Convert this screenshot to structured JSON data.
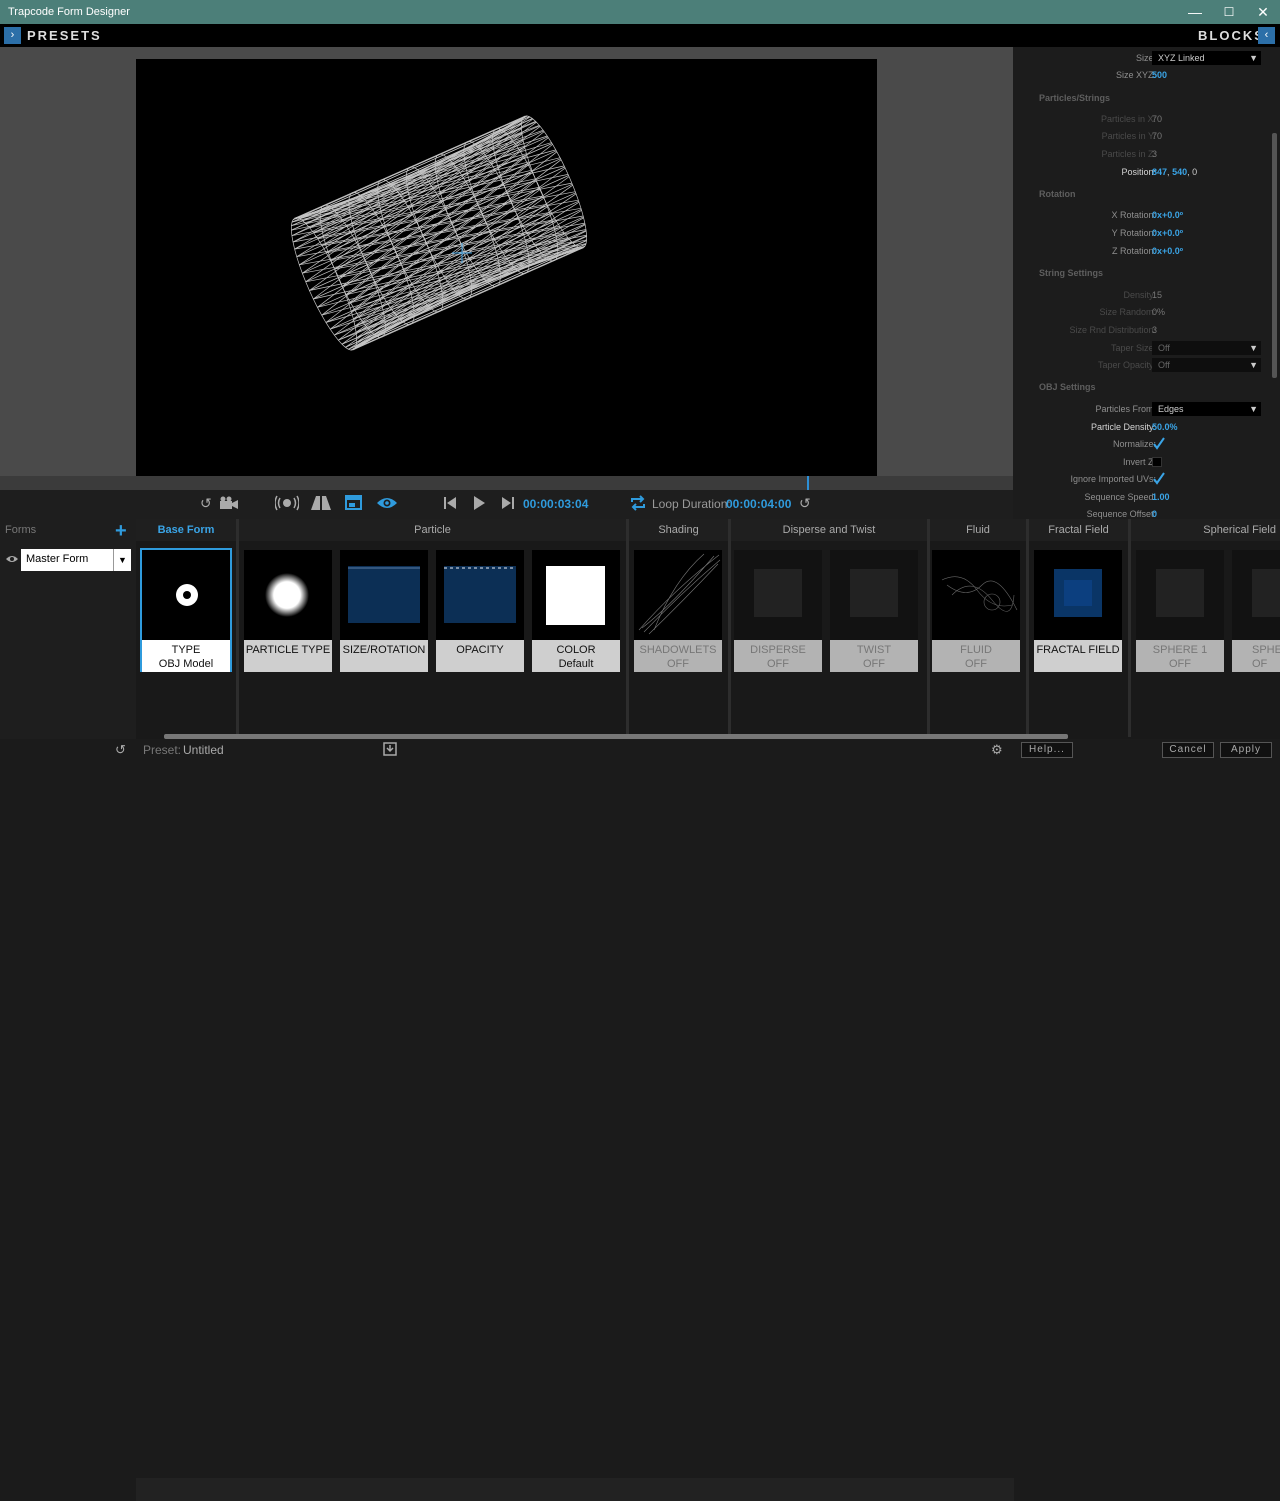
{
  "window": {
    "title": "Trapcode Form Designer",
    "minimize": "—",
    "maximize": "☐",
    "close": "✕"
  },
  "topbar": {
    "presets_label": "PRESETS",
    "blocks_label": "BLOCKS",
    "left_chevron": "›",
    "right_chevron": "‹"
  },
  "transport": {
    "current_time": "00:00:03:04",
    "loop_label": "Loop Duration:",
    "loop_time": "00:00:04:00"
  },
  "right_panel": {
    "size_label": "Size:",
    "size_value": "XYZ Linked",
    "size_xyz_label": "Size XYZ:",
    "size_xyz_value": "500",
    "particles_section": "Particles/Strings",
    "pnx_label": "Particles in X:",
    "pnx_value": "70",
    "pny_label": "Particles in Y:",
    "pny_value": "70",
    "pnz_label": "Particles in Z:",
    "pnz_value": "3",
    "position_label": "Position:",
    "position_x": "847",
    "position_sep1": ",",
    "position_y": "540",
    "position_sep2": ",",
    "position_z": "0",
    "rotation_section": "Rotation",
    "xrot_label": "X Rotation:",
    "xrot_value": "0x+0.0º",
    "yrot_label": "Y Rotation:",
    "yrot_value": "0x+0.0º",
    "zrot_label": "Z Rotation:",
    "zrot_value": "0x+0.0º",
    "string_section": "String Settings",
    "density_label": "Density:",
    "density_value": "15",
    "size_random_label": "Size Random:",
    "size_random_value": "0%",
    "size_dist_label": "Size Rnd Distribution:",
    "size_dist_value": "3",
    "taper_size_label": "Taper Size:",
    "taper_size_value": "Off",
    "taper_opacity_label": "Taper Opacity:",
    "taper_opacity_value": "Off",
    "obj_section": "OBJ Settings",
    "particles_from_label": "Particles From:",
    "particles_from_value": "Edges",
    "particle_density_label": "Particle Density:",
    "particle_density_value": "50.0%",
    "normalize_label": "Normalize:",
    "invert_z_label": "Invert Z:",
    "ignore_uvs_label": "Ignore Imported UVs:",
    "seq_speed_label": "Sequence Speed:",
    "seq_speed_value": "1.00",
    "seq_offset_label": "Sequence Offset:",
    "seq_offset_value": "0"
  },
  "forms": {
    "header": "Forms",
    "add": "+",
    "master_form": "Master Form"
  },
  "groups": {
    "base_form": "Base Form",
    "particle": "Particle",
    "shading": "Shading",
    "disperse": "Disperse and Twist",
    "fluid": "Fluid",
    "fractal": "Fractal Field",
    "spherical": "Spherical Field"
  },
  "blocks": [
    {
      "title": "TYPE",
      "sub": "OBJ Model"
    },
    {
      "title": "PARTICLE TYPE",
      "sub": ""
    },
    {
      "title": "SIZE/ROTATION",
      "sub": ""
    },
    {
      "title": "OPACITY",
      "sub": ""
    },
    {
      "title": "COLOR",
      "sub": "Default"
    },
    {
      "title": "SHADOWLETS",
      "sub": "OFF"
    },
    {
      "title": "DISPERSE",
      "sub": "OFF"
    },
    {
      "title": "TWIST",
      "sub": "OFF"
    },
    {
      "title": "FLUID",
      "sub": "OFF"
    },
    {
      "title": "FRACTAL FIELD",
      "sub": ""
    },
    {
      "title": "SPHERE 1",
      "sub": "OFF"
    },
    {
      "title": "SPHERE",
      "sub": "OF"
    }
  ],
  "status": {
    "preset_label": "Preset:",
    "preset_value": "Untitled",
    "help": "Help...",
    "cancel": "Cancel",
    "apply": "Apply"
  }
}
